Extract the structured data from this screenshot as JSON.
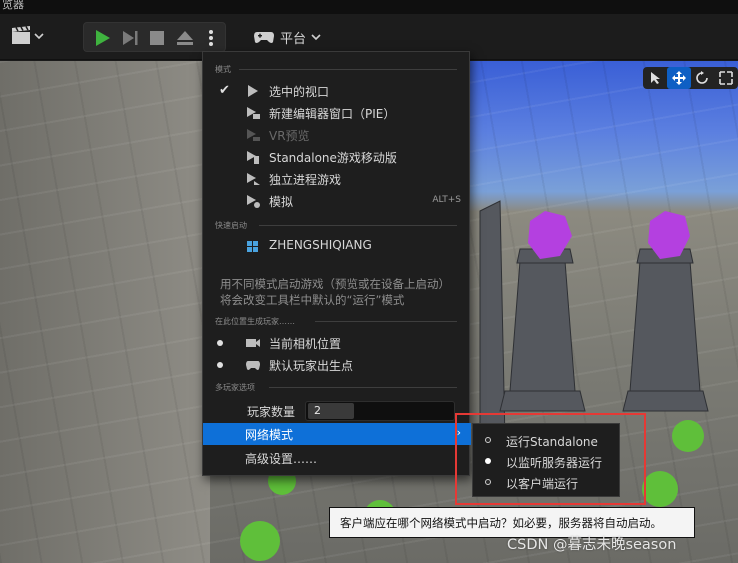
{
  "window": {
    "title_fragment": "览器"
  },
  "toolbar": {
    "platform_label": "平台"
  },
  "menu": {
    "sections": {
      "modes": "模式",
      "quick_launch": "快速启动",
      "spawn": "在此位置生成玩家……",
      "multiplayer": "多玩家选项"
    },
    "items": [
      {
        "label": "选中的视口",
        "checked": true,
        "disabled": false,
        "shortcut": ""
      },
      {
        "label": "新建编辑器窗口（PIE）",
        "checked": false,
        "disabled": false,
        "shortcut": ""
      },
      {
        "label": "VR预览",
        "checked": false,
        "disabled": true,
        "shortcut": ""
      },
      {
        "label": "Standalone游戏移动版",
        "checked": false,
        "disabled": false,
        "shortcut": ""
      },
      {
        "label": "独立进程游戏",
        "checked": false,
        "disabled": false,
        "shortcut": ""
      },
      {
        "label": "模拟",
        "checked": false,
        "disabled": false,
        "shortcut": "ALT+S"
      }
    ],
    "device_label": "ZHENGSHIQIANG",
    "description": "用不同模式启动游戏（预览或在设备上启动）将会改变工具栏中默认的“运行”模式",
    "spawn_options": [
      {
        "label": "当前相机位置",
        "selected": true
      },
      {
        "label": "默认玩家出生点",
        "selected": false
      }
    ],
    "player_count_label": "玩家数量",
    "player_count_value": "2",
    "net_mode_label": "网络模式",
    "advanced_label": "高级设置……"
  },
  "submenu": {
    "items": [
      {
        "label": "运行Standalone",
        "selected": false
      },
      {
        "label": "以监听服务器运行",
        "selected": true
      },
      {
        "label": "以客户端运行",
        "selected": false
      }
    ]
  },
  "tooltip": {
    "text": "客户端应在哪个网络模式中启动？如必要，服务器将自动启动。"
  },
  "watermark": {
    "text": "CSDN @暮志未晚season"
  },
  "colors": {
    "highlight": "#0e70d8",
    "annotation": "#e53935",
    "play": "#3fb33f"
  }
}
